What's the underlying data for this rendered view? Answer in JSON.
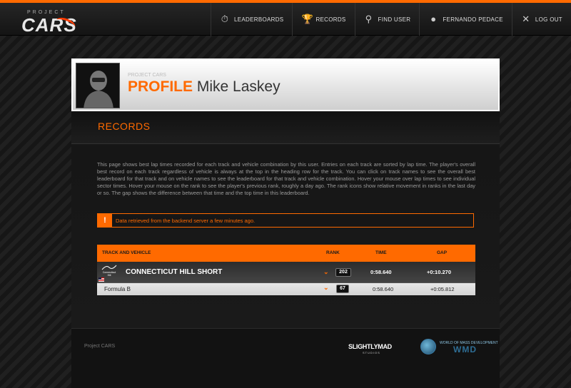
{
  "brand": {
    "small": "PROJECT",
    "big": "CARS"
  },
  "nav": [
    {
      "label": "LEADERBOARDS",
      "icon": "stopwatch-icon"
    },
    {
      "label": "RECORDS",
      "icon": "trophy-icon"
    },
    {
      "label": "FIND USER",
      "icon": "search-icon"
    },
    {
      "label": "FERNANDO PEDACE",
      "icon": "user-icon"
    },
    {
      "label": "LOG OUT",
      "icon": "close-icon"
    }
  ],
  "profile": {
    "breadcrumb": "PROJECT CARS",
    "word": "PROFILE",
    "name": "Mike Laskey"
  },
  "section_title": "RECORDS",
  "description": "This page shows best lap times recorded for each track and vehicle combination by this user. Entries on each track are sorted by lap time. The player's overall best record on each track regardless of vehicle is always at the top in the heading row for the track. You can click on track names to see the overall best leaderboard for that track and on vehicle names to see the leaderboard for that track and vehicle combination. Hover your mouse over lap times to see individual sector times. Hover your mouse on the rank to see the player's previous rank, roughly a day ago. The rank icons show relative movement in ranks in the last day or so. The gap shows the difference between that time and the top time in this leaderboard.",
  "notice": {
    "icon": "!",
    "text": "Data retrieved from the backend server a few minutes ago."
  },
  "table": {
    "headers": {
      "track": "TRACK AND VEHICLE",
      "rank": "RANK",
      "time": "TIME",
      "gap": "GAP"
    },
    "track": {
      "logo_text": "Connecticut Hill",
      "name": "CONNECTICUT HILL SHORT",
      "rank": "202",
      "time": "0:58.640",
      "gap": "+0:10.270"
    },
    "vehicle": {
      "name": "Formula B",
      "rank": "67",
      "time": "0:58.640",
      "gap": "+0:05.812"
    }
  },
  "footer": {
    "text": "Project CARS",
    "partner1": "SLIGHTLYMAD",
    "partner1_sub": "STUDIOS",
    "partner2_top": "WORLD OF MASS DEVELOPMENT",
    "partner2_big": "WMD"
  },
  "colors": {
    "accent": "#ff6a00",
    "background": "#1c1c1c"
  }
}
